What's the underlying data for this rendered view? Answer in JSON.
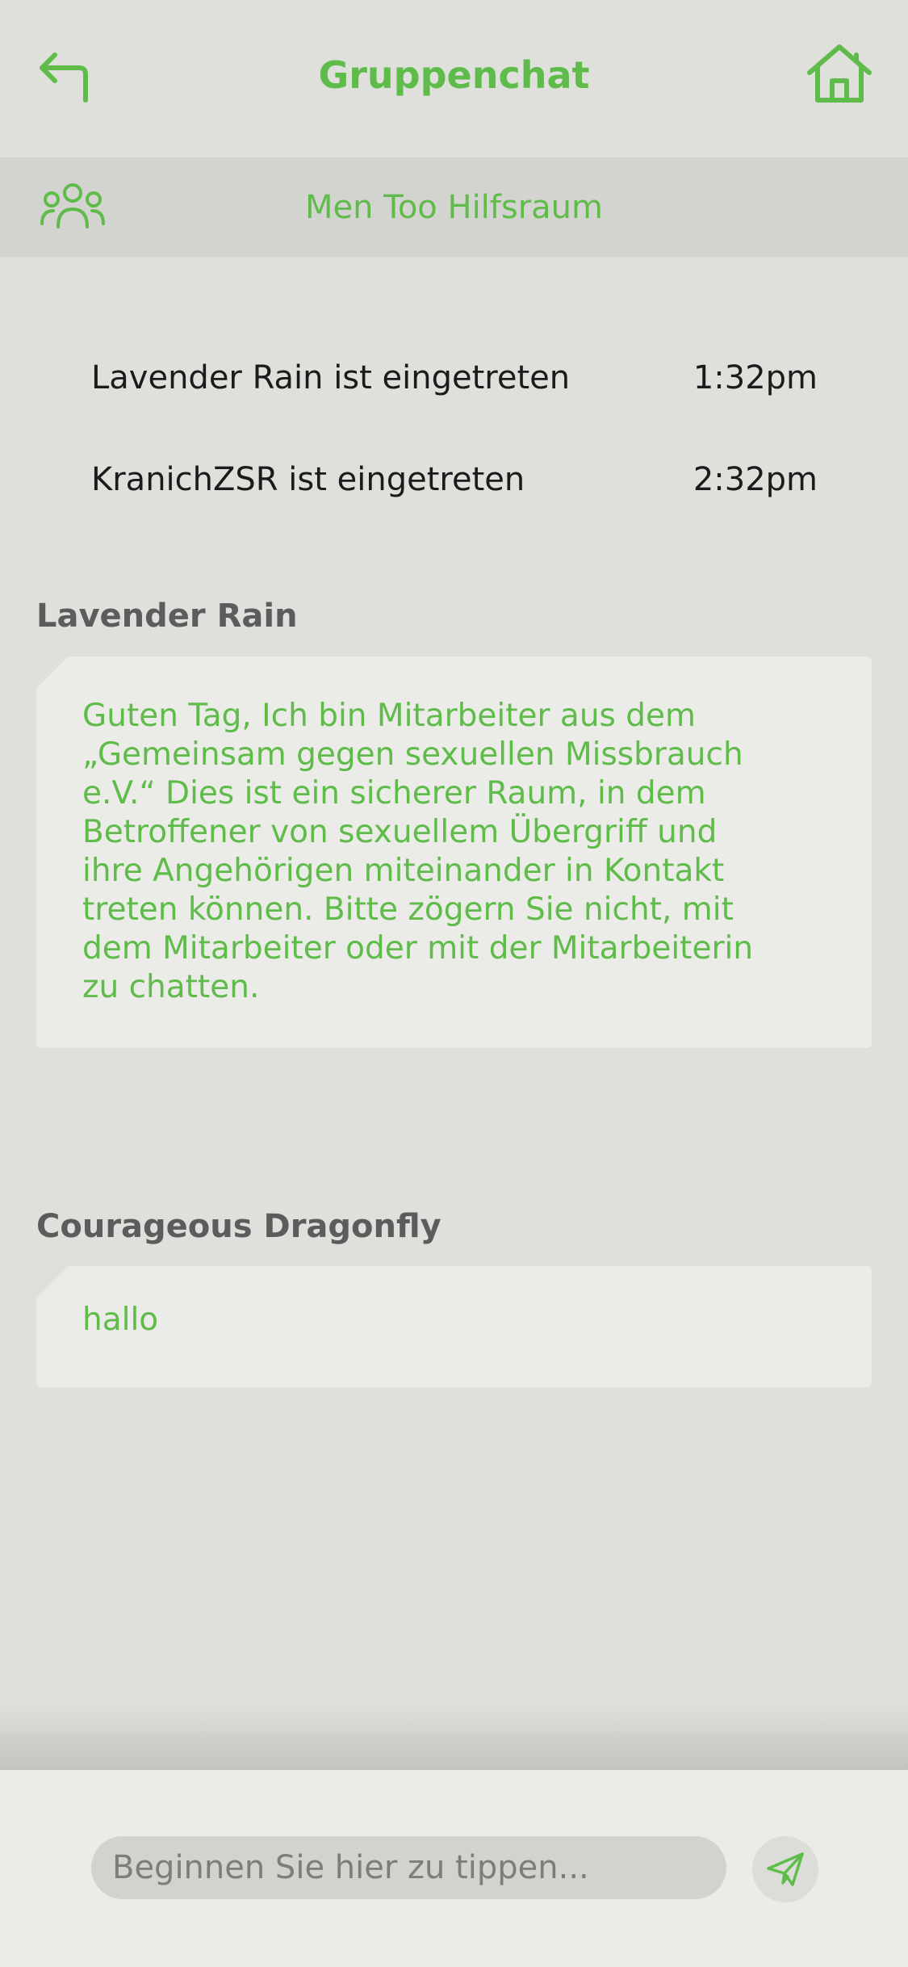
{
  "header": {
    "title": "Gruppenchat",
    "back_icon": "back-arrow-icon",
    "home_icon": "home-icon"
  },
  "group": {
    "name": "Men Too Hilfsraum",
    "icon": "group-icon"
  },
  "events": [
    {
      "text": "Lavender Rain ist eingetreten",
      "time": "1:32pm"
    },
    {
      "text": "KranichZSR ist eingetreten",
      "time": "2:32pm"
    }
  ],
  "messages": [
    {
      "sender": "Lavender Rain",
      "text": "Guten Tag, Ich bin Mitarbeiter aus dem\n„Gemeinsam gegen sexuellen Missbrauch\ne.V.“ Dies ist ein sicherer Raum, in dem\nBetroffener von sexuellem Übergriff und\nihre Angehörigen miteinander in Kontakt\ntreten können. Bitte zögern Sie nicht, mit\ndem Mitarbeiter oder mit der Mitarbeiterin\nzu chatten."
    },
    {
      "sender": "Courageous Dragonfly",
      "text": "hallo"
    }
  ],
  "composer": {
    "placeholder": "Beginnen Sie hier zu tippen...",
    "value": "",
    "send_icon": "send-icon"
  },
  "colors": {
    "accent": "#5fbc4a",
    "background": "#dfdfdb",
    "bubble": "#ebebe7"
  }
}
